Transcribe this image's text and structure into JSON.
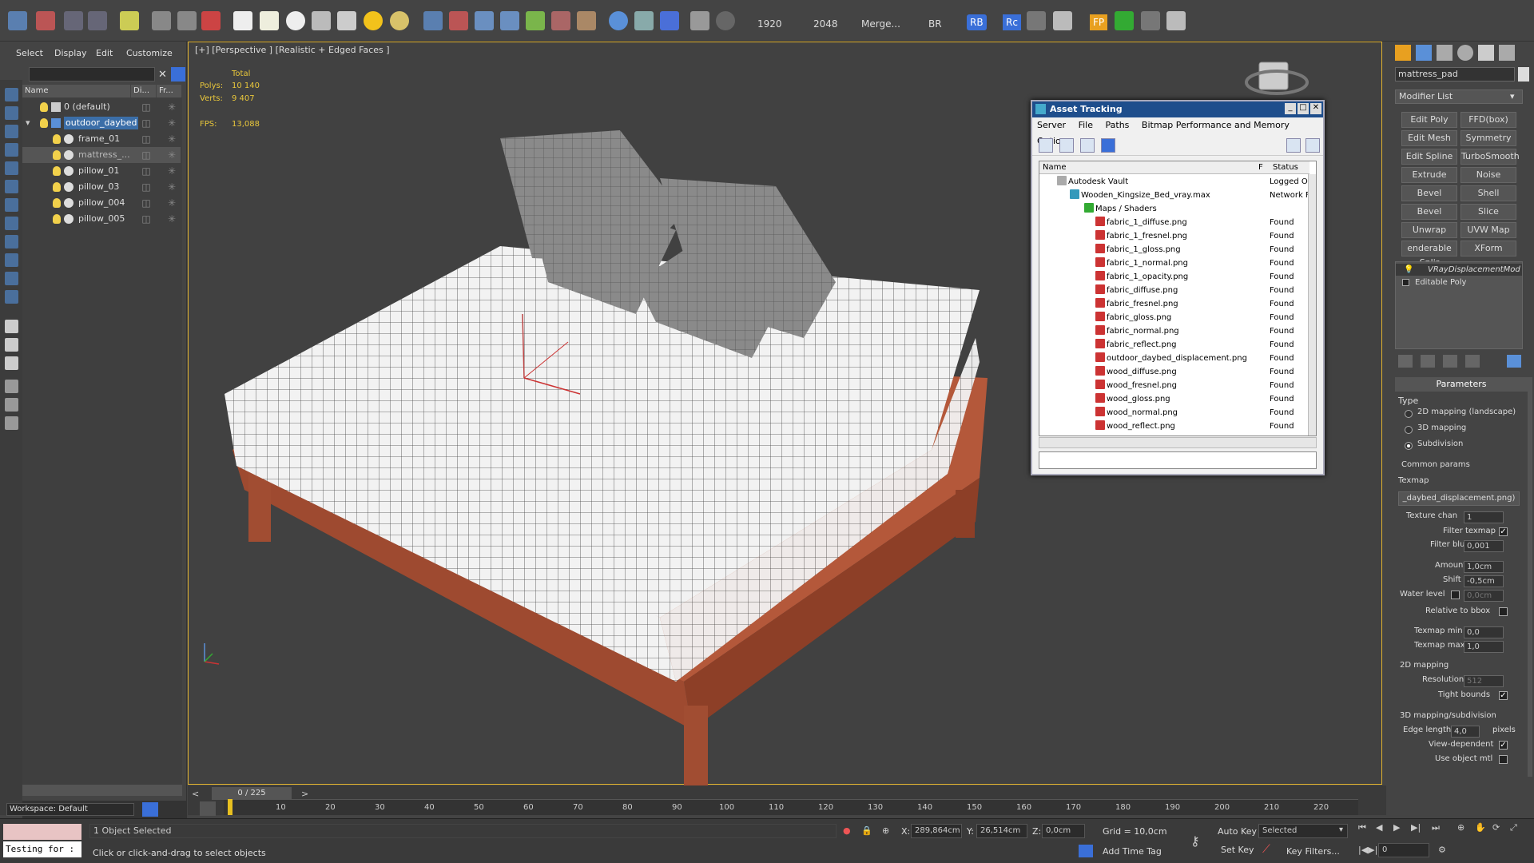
{
  "toolbar": {
    "render_width": "1920",
    "render_height": "2048",
    "merge_label": "Merge...",
    "br_label": "BR",
    "rb_label": "RB",
    "rc_label": "Rc",
    "fp_label": "FP"
  },
  "scene_explorer": {
    "menu": [
      "Select",
      "Display",
      "Edit",
      "Customize"
    ],
    "columns": [
      "Name",
      "Di...",
      "Fr..."
    ],
    "items": [
      {
        "label": "0 (default)"
      },
      {
        "label": "outdoor_daybed"
      },
      {
        "label": "frame_01"
      },
      {
        "label": "mattress_..."
      },
      {
        "label": "pillow_01"
      },
      {
        "label": "pillow_03"
      },
      {
        "label": "pillow_004"
      },
      {
        "label": "pillow_005"
      }
    ],
    "workspace": "Workspace: Default"
  },
  "viewport": {
    "label": "[+] [Perspective ] [Realistic + Edged Faces ]",
    "stats": {
      "total_label": "Total",
      "polys_label": "Polys:",
      "polys_value": "10 140",
      "verts_label": "Verts:",
      "verts_value": "9 407",
      "fps_label": "FPS:",
      "fps_value": "13,088"
    }
  },
  "asset_tracking": {
    "title": "Asset Tracking",
    "menu": [
      "Server",
      "File",
      "Paths",
      "Bitmap Performance and Memory",
      "Options"
    ],
    "columns": [
      "Name",
      "F",
      "Status"
    ],
    "rows": [
      {
        "name": "Autodesk Vault",
        "status": "Logged O"
      },
      {
        "name": "Wooden_Kingsize_Bed_vray.max",
        "status": "Network F"
      },
      {
        "name": "Maps / Shaders",
        "status": ""
      },
      {
        "name": "fabric_1_diffuse.png",
        "status": "Found"
      },
      {
        "name": "fabric_1_fresnel.png",
        "status": "Found"
      },
      {
        "name": "fabric_1_gloss.png",
        "status": "Found"
      },
      {
        "name": "fabric_1_normal.png",
        "status": "Found"
      },
      {
        "name": "fabric_1_opacity.png",
        "status": "Found"
      },
      {
        "name": "fabric_diffuse.png",
        "status": "Found"
      },
      {
        "name": "fabric_fresnel.png",
        "status": "Found"
      },
      {
        "name": "fabric_gloss.png",
        "status": "Found"
      },
      {
        "name": "fabric_normal.png",
        "status": "Found"
      },
      {
        "name": "fabric_reflect.png",
        "status": "Found"
      },
      {
        "name": "outdoor_daybed_displacement.png",
        "status": "Found"
      },
      {
        "name": "wood_diffuse.png",
        "status": "Found"
      },
      {
        "name": "wood_fresnel.png",
        "status": "Found"
      },
      {
        "name": "wood_gloss.png",
        "status": "Found"
      },
      {
        "name": "wood_normal.png",
        "status": "Found"
      },
      {
        "name": "wood_reflect.png",
        "status": "Found"
      }
    ]
  },
  "command_panel": {
    "object_name": "mattress_pad",
    "modifier_list": "Modifier List",
    "buttons": [
      "Edit Poly",
      "FFD(box)",
      "Edit Mesh",
      "Symmetry",
      "Edit Spline",
      "TurboSmooth",
      "Extrude",
      "Noise",
      "Bevel",
      "Shell",
      "Bevel Profile",
      "Slice",
      "Unwrap UVW",
      "UVW Map",
      "enderable Splir",
      "XForm"
    ],
    "stack": [
      "VRayDisplacementMod",
      "Editable Poly"
    ],
    "parameters_title": "Parameters",
    "type_label": "Type",
    "type_options": [
      "2D mapping (landscape)",
      "3D mapping",
      "Subdivision"
    ],
    "type_selected": "Subdivision",
    "common_params": "Common params",
    "texmap_label": "Texmap",
    "texmap_value": "_daybed_displacement.png)",
    "texture_chan_label": "Texture chan",
    "texture_chan_value": "1",
    "filter_texmap_label": "Filter texmap",
    "filter_blur_label": "Filter blur",
    "filter_blur_value": "0,001",
    "amount_label": "Amount",
    "amount_value": "1,0cm",
    "shift_label": "Shift",
    "shift_value": "-0,5cm",
    "water_level_label": "Water level",
    "water_level_value": "0,0cm",
    "relative_bbox_label": "Relative to bbox",
    "texmap_min_label": "Texmap min",
    "texmap_min_value": "0,0",
    "texmap_max_label": "Texmap max",
    "texmap_max_value": "1,0",
    "mapping2d_label": "2D mapping",
    "resolution_label": "Resolution",
    "resolution_value": "512",
    "tight_bounds_label": "Tight bounds",
    "mapping3d_label": "3D mapping/subdivision",
    "edge_length_label": "Edge length",
    "edge_length_value": "4,0",
    "pixels_label": "pixels",
    "view_dependent_label": "View-dependent",
    "use_object_mtl_label": "Use object mtl"
  },
  "timeline": {
    "frame_counter": "0 / 225",
    "ticks": [
      "10",
      "20",
      "30",
      "40",
      "50",
      "60",
      "70",
      "80",
      "90",
      "100",
      "110",
      "120",
      "130",
      "140",
      "150",
      "160",
      "170",
      "180",
      "190",
      "200",
      "210",
      "220"
    ]
  },
  "status_bar": {
    "maxscript": "Testing for :",
    "selection": "1 Object Selected",
    "prompt": "Click or click-and-drag to select objects",
    "x_label": "X:",
    "x_value": "289,864cm",
    "y_label": "Y:",
    "y_value": "26,514cm",
    "z_label": "Z:",
    "z_value": "0,0cm",
    "grid": "Grid = 10,0cm",
    "add_time_tag": "Add Time Tag",
    "auto_key": "Auto Key",
    "set_key": "Set Key",
    "selected": "Selected",
    "key_filters": "Key Filters...",
    "current_frame": "0"
  }
}
